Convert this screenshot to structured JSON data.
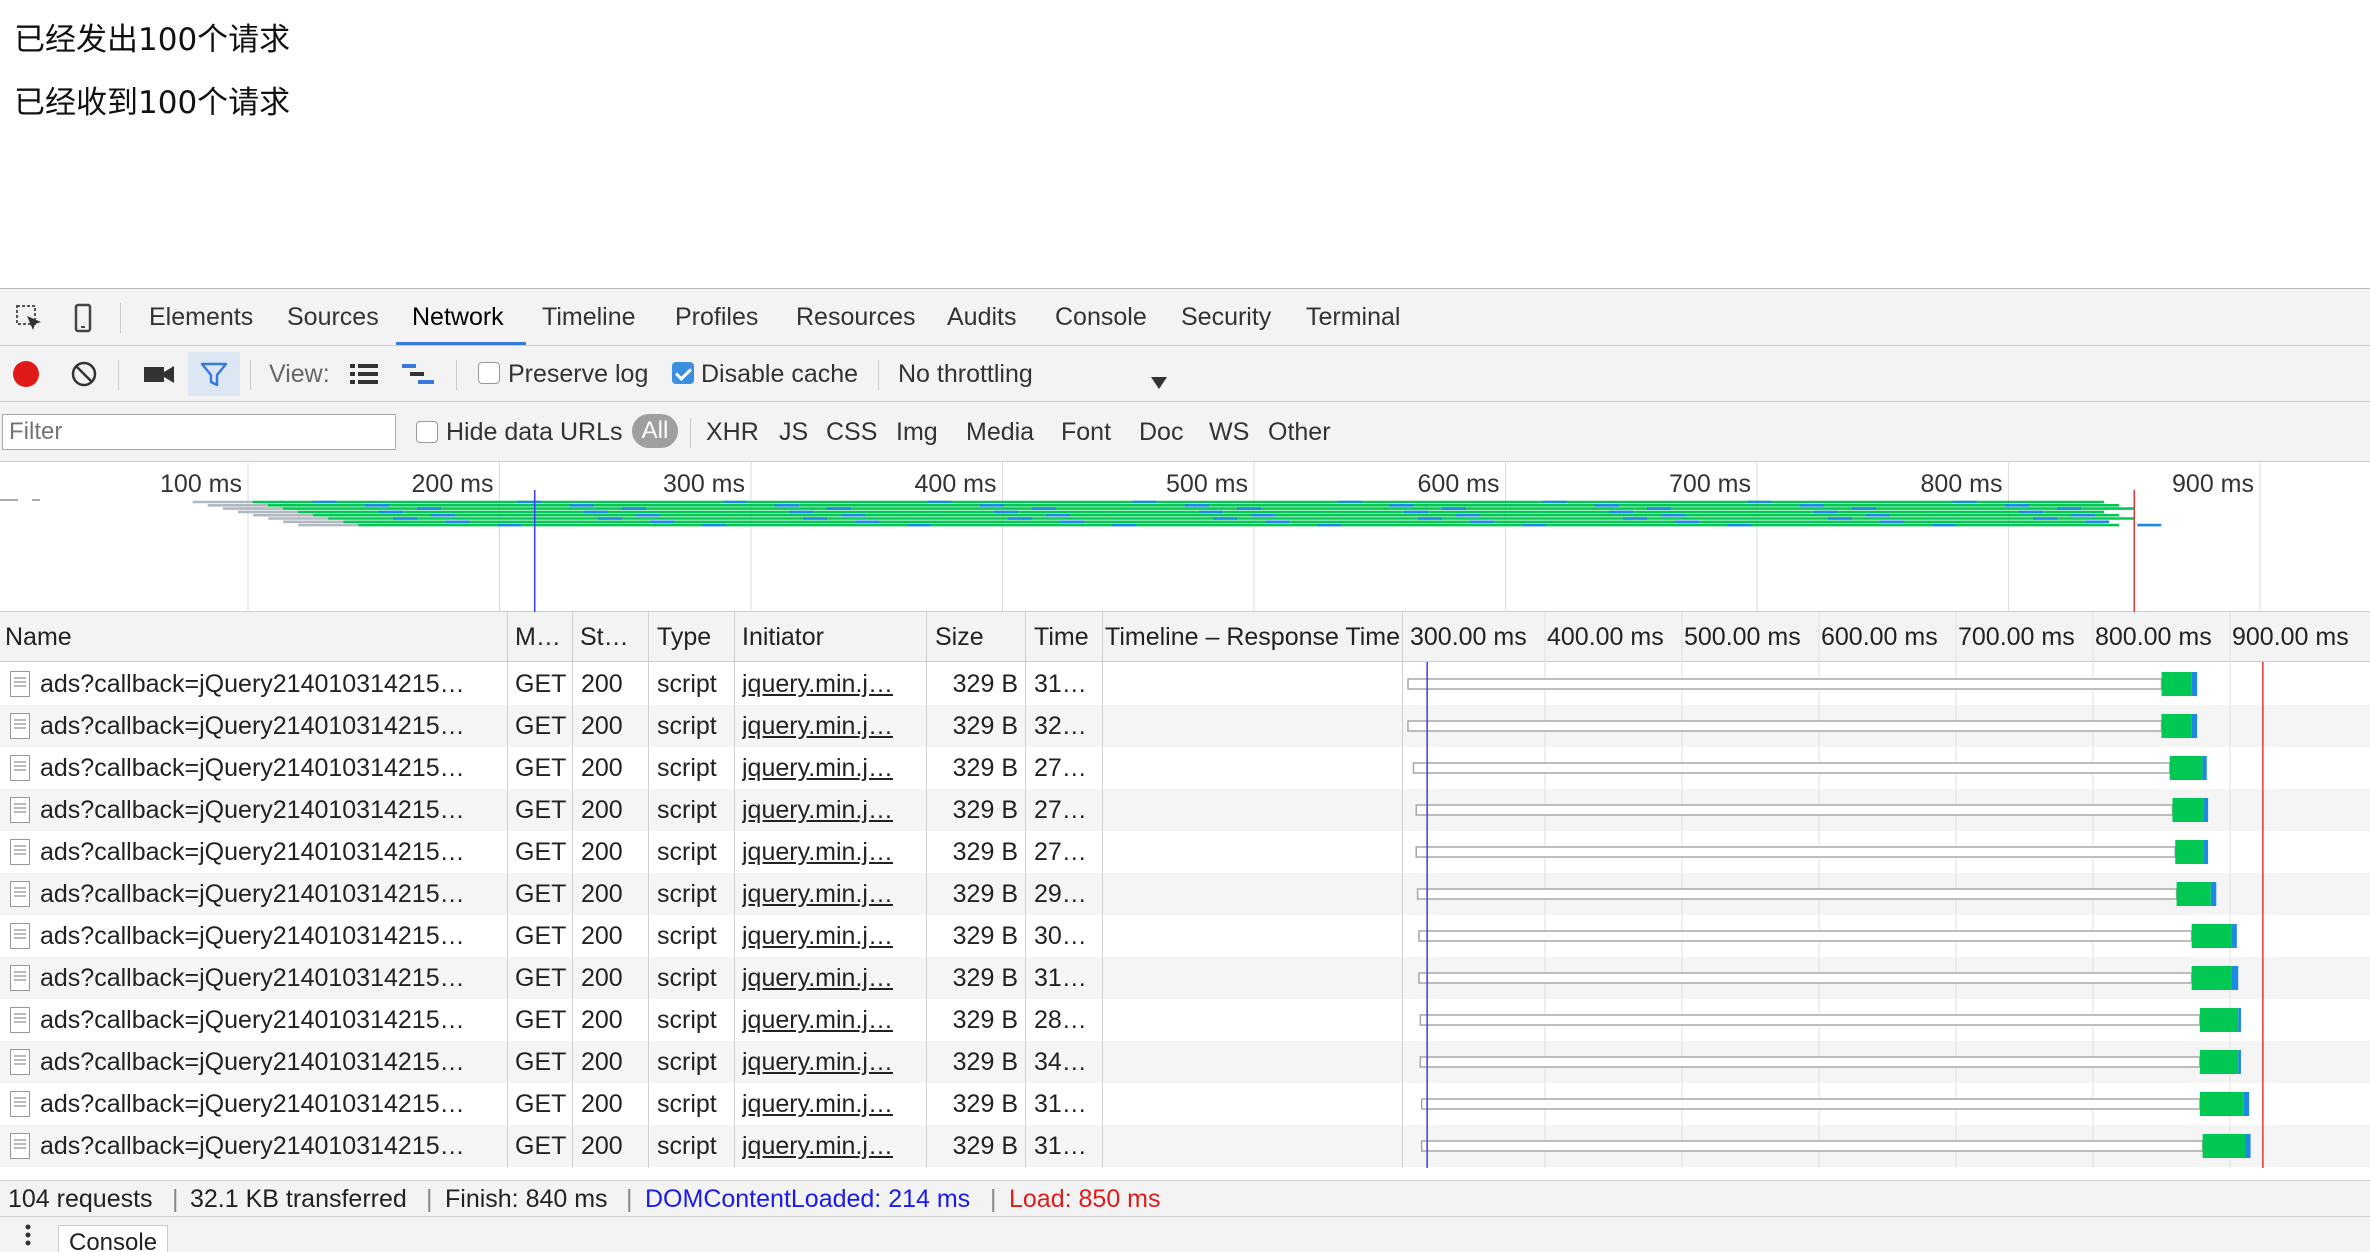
{
  "page": {
    "line1": "已经发出100个请求",
    "line2": "已经收到100个请求"
  },
  "devtools": {
    "tabs": [
      "Elements",
      "Sources",
      "Network",
      "Timeline",
      "Profiles",
      "Resources",
      "Audits",
      "Console",
      "Security",
      "Terminal"
    ],
    "active_tab": "Network",
    "toolbar": {
      "view_label": "View:",
      "preserve_log_label": "Preserve log",
      "preserve_log_checked": false,
      "disable_cache_label": "Disable cache",
      "disable_cache_checked": true,
      "throttling_value": "No throttling"
    },
    "filter": {
      "placeholder": "Filter",
      "hide_data_urls_label": "Hide data URLs",
      "types": [
        "All",
        "XHR",
        "JS",
        "CSS",
        "Img",
        "Media",
        "Font",
        "Doc",
        "WS",
        "Other"
      ]
    },
    "overview": {
      "ticks": [
        "100 ms",
        "200 ms",
        "300 ms",
        "400 ms",
        "500 ms",
        "600 ms",
        "700 ms",
        "800 ms",
        "900 ms"
      ],
      "domcontentloaded_ms": 214,
      "load_ms": 850
    },
    "grid": {
      "headers": {
        "name": "Name",
        "method": "M…",
        "status": "St…",
        "type": "Type",
        "initiator": "Initiator",
        "size": "Size",
        "time": "Time",
        "timeline": "Timeline – Response Time"
      },
      "waterfall_ticks": [
        "300.00 ms",
        "400.00 ms",
        "500.00 ms",
        "600.00 ms",
        "700.00 ms",
        "800.00 ms",
        "900.00 ms"
      ],
      "rows": [
        {
          "name": "ads?callback=jQuery214010314215…",
          "method": "GET",
          "status": "200",
          "type": "script",
          "initiator": "jquery.min.j…",
          "size": "329 B",
          "time": "31…"
        },
        {
          "name": "ads?callback=jQuery214010314215…",
          "method": "GET",
          "status": "200",
          "type": "script",
          "initiator": "jquery.min.j…",
          "size": "329 B",
          "time": "32…"
        },
        {
          "name": "ads?callback=jQuery214010314215…",
          "method": "GET",
          "status": "200",
          "type": "script",
          "initiator": "jquery.min.j…",
          "size": "329 B",
          "time": "27…"
        },
        {
          "name": "ads?callback=jQuery214010314215…",
          "method": "GET",
          "status": "200",
          "type": "script",
          "initiator": "jquery.min.j…",
          "size": "329 B",
          "time": "27…"
        },
        {
          "name": "ads?callback=jQuery214010314215…",
          "method": "GET",
          "status": "200",
          "type": "script",
          "initiator": "jquery.min.j…",
          "size": "329 B",
          "time": "27…"
        },
        {
          "name": "ads?callback=jQuery214010314215…",
          "method": "GET",
          "status": "200",
          "type": "script",
          "initiator": "jquery.min.j…",
          "size": "329 B",
          "time": "29…"
        },
        {
          "name": "ads?callback=jQuery214010314215…",
          "method": "GET",
          "status": "200",
          "type": "script",
          "initiator": "jquery.min.j…",
          "size": "329 B",
          "time": "30…"
        },
        {
          "name": "ads?callback=jQuery214010314215…",
          "method": "GET",
          "status": "200",
          "type": "script",
          "initiator": "jquery.min.j…",
          "size": "329 B",
          "time": "31…"
        },
        {
          "name": "ads?callback=jQuery214010314215…",
          "method": "GET",
          "status": "200",
          "type": "script",
          "initiator": "jquery.min.j…",
          "size": "329 B",
          "time": "28…"
        },
        {
          "name": "ads?callback=jQuery214010314215…",
          "method": "GET",
          "status": "200",
          "type": "script",
          "initiator": "jquery.min.j…",
          "size": "329 B",
          "time": "34…"
        },
        {
          "name": "ads?callback=jQuery214010314215…",
          "method": "GET",
          "status": "200",
          "type": "script",
          "initiator": "jquery.min.j…",
          "size": "329 B",
          "time": "31…"
        },
        {
          "name": "ads?callback=jQuery214010314215…",
          "method": "GET",
          "status": "200",
          "type": "script",
          "initiator": "jquery.min.j…",
          "size": "329 B",
          "time": "31…"
        }
      ]
    },
    "status": {
      "requests": "104 requests",
      "transferred": "32.1 KB transferred",
      "finish": "Finish: 840 ms",
      "dcl": "DOMContentLoaded: 214 ms",
      "load": "Load: 850 ms",
      "sep": "|"
    },
    "drawer": {
      "console_tab": "Console"
    },
    "colors": {
      "accent": "#3879d9",
      "waiting": "#00c853",
      "receiving": "#1e88e5",
      "dcl_line": "#3b3bff",
      "load_line": "#e53935",
      "record": "#e01919"
    }
  }
}
